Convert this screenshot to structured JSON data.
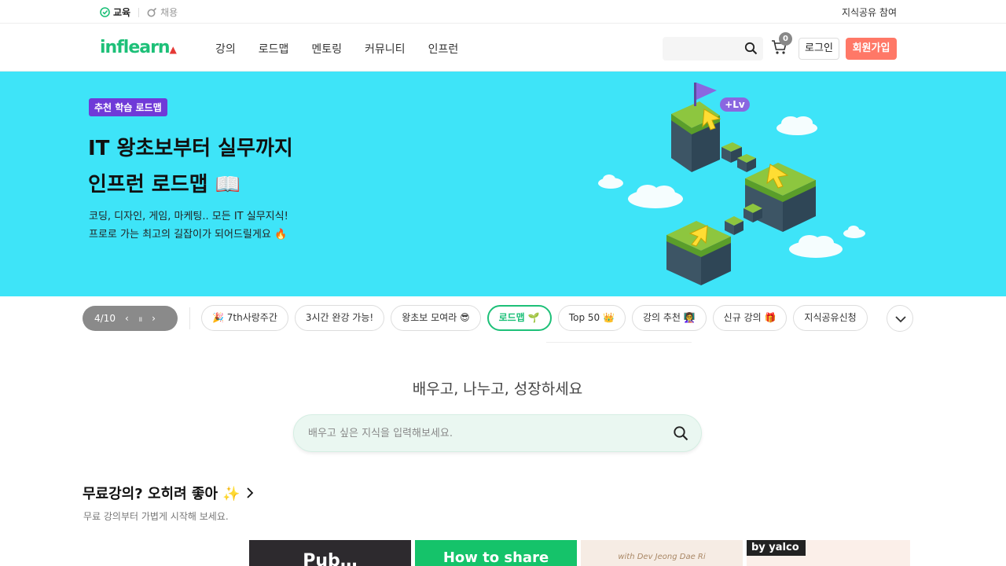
{
  "topbar": {
    "tab_education": "교육",
    "tab_jobs": "채용",
    "knowledge_share": "지식공유 참여"
  },
  "header": {
    "logo_text": "inflearn",
    "nav": [
      "강의",
      "로드맵",
      "멘토링",
      "커뮤니티",
      "인프런"
    ],
    "cart_count": "0",
    "login": "로그인",
    "signup": "회원가입"
  },
  "hero": {
    "badge": "추천 학습 로드맵",
    "title_line1": "IT 왕초보부터 실무까지",
    "title_line2": "인프런 로드맵 📖",
    "sub_line1": "코딩, 디자인, 게임, 마케팅.. 모든 IT 실무지식!",
    "sub_line2": "프로로 가는 최고의 길잡이가 되어드릴게요 🔥",
    "art_label": "+Lv"
  },
  "carousel": {
    "position": "4/10",
    "prev": "‹",
    "pause": "॥",
    "next": "›"
  },
  "pills": [
    "🎉 7th사랑주간",
    "3시간 완강 가능!",
    "왕초보 모여라 😎",
    "로드맵 🌱",
    "Top 50 👑",
    "강의 추천 👩‍🏫",
    "신규 강의 🎁",
    "지식공유신청"
  ],
  "main": {
    "tagline": "배우고, 나누고, 성장하세요",
    "search_placeholder": "배우고 싶은 지식을 입력해보세요."
  },
  "section": {
    "title": "무료강의? 오히려 좋아 ✨",
    "subtitle": "무료 강의부터 가볍게 시작해 보세요."
  },
  "cards": {
    "card1_text": "Pub…",
    "card2_text": "How to share",
    "card3_text": "with Dev Jeong Dae Ri",
    "card4_brand": "by yalco"
  },
  "colors": {
    "brand_green": "#1dc078",
    "hero_bg": "#3ee4f8",
    "signup": "#ff7867",
    "badge_purple": "#6f3ad8"
  }
}
